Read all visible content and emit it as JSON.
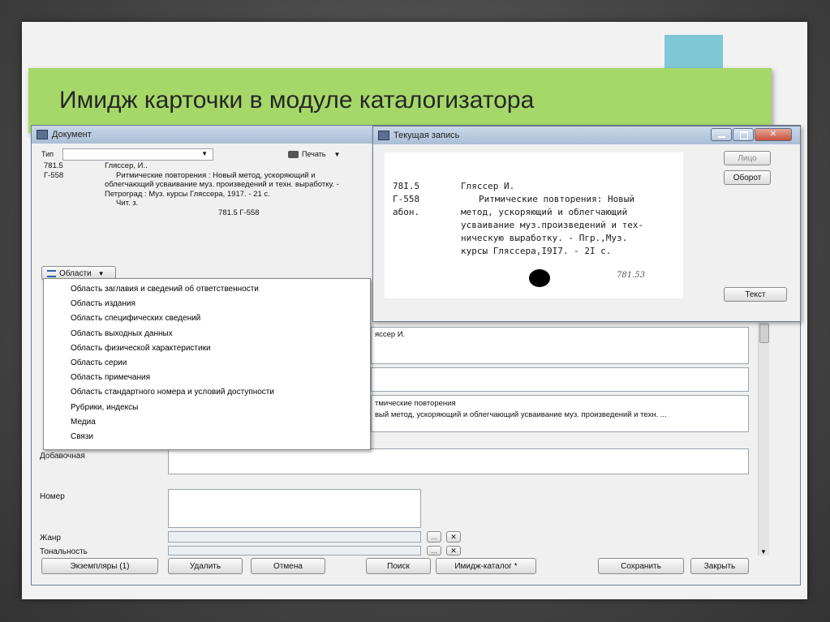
{
  "slide": {
    "title": "Имидж карточки в модуле каталогизатора"
  },
  "document_window": {
    "title": "Документ",
    "type_label": "Тип",
    "print_label": "Печать",
    "card": {
      "class_lines": [
        "781.5",
        "Г-558"
      ],
      "author": "Гляссер, И..",
      "text": "Ритмические повторения : Новый метод, ускоряющий и облегчающий усваивание муз. произведений и техн. выработку. - Петроград : Муз. курсы Гляссера, 1917. - 21 с.",
      "reading": "Чит. з.",
      "shelfmark": "781.5 Г-558"
    },
    "areas_button": "Области",
    "areas_menu": [
      "Область заглавия и сведений об ответственности",
      "Область издания",
      "Область специфических сведений",
      "Область выходных данных",
      "Область физической характеристики",
      "Область серии",
      "Область примечания",
      "Область стандартного номера и условий доступности",
      "Рубрики, индексы",
      "Медиа",
      "Связи"
    ],
    "fields": {
      "author_value": "яссер И.",
      "title_value": "тмические повторения",
      "subtitle_value": "вый метод, ускоряющий и облегчающий усваивание муз. произведений и техн. ...",
      "additional_label": "Добавочная",
      "number_label": "Номер",
      "genre_label": "Жанр",
      "tonality_label": "Тональность"
    },
    "buttons": {
      "copies": "Экземпляры (1)",
      "delete": "Удалить",
      "cancel": "Отмена",
      "search": "Поиск",
      "image_catalog": "Имидж-каталог *",
      "save": "Сохранить",
      "close": "Закрыть"
    }
  },
  "current_record_window": {
    "title": "Текущая запись",
    "scan": {
      "class_lines": [
        "78I.5",
        "Г-558",
        "абон."
      ],
      "lines": [
        "Гляссер И.",
        "Ритмические повторения: Новый",
        "метод, ускоряющий и облегчающий",
        "усваивание муз.произведений и тех-",
        "ническую выработку. - Пгр.,Муз.",
        "курсы Гляссера,I9I7. - 2I с."
      ],
      "handwritten": "781.53"
    },
    "buttons": {
      "face": "Лицо",
      "reverse": "Оборот",
      "text": "Текст"
    }
  },
  "colors": {
    "title_band": "#a6d869",
    "accent_tab": "#80c7d6"
  }
}
